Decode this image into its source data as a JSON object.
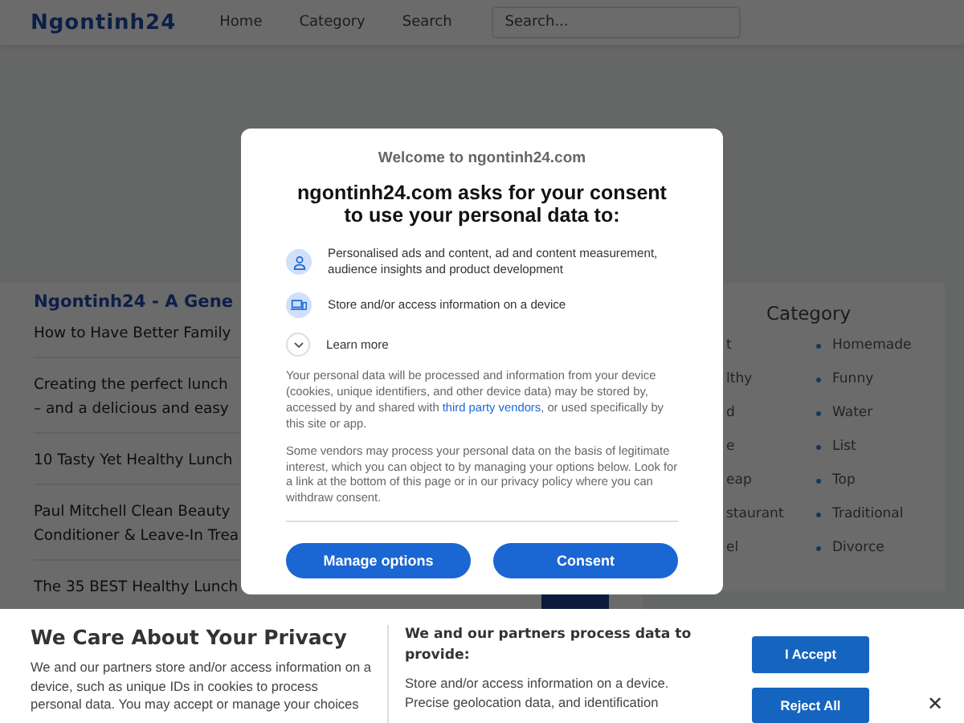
{
  "header": {
    "logo": "Ngontinh24",
    "nav": [
      "Home",
      "Category",
      "Search"
    ],
    "search": {
      "placeholder": "Search..."
    }
  },
  "articles": {
    "title": "Ngontinh24 - A Gene",
    "items": [
      {
        "lines": [
          "How to Have Better Family"
        ]
      },
      {
        "lines": [
          "Creating the perfect lunch",
          "– and a delicious and easy"
        ]
      },
      {
        "lines": [
          "10 Tasty Yet Healthy Lunch"
        ]
      },
      {
        "lines": [
          "Paul Mitchell Clean Beauty",
          "Conditioner & Leave-In Trea"
        ]
      },
      {
        "lines": [
          "The 35 BEST Healthy Lunch"
        ]
      }
    ]
  },
  "categories": {
    "title": "Category",
    "column_1": [
      "t",
      "lthy",
      "d",
      "e",
      "eap",
      "staurant",
      "el"
    ],
    "column_2": [
      "Homemade",
      "Funny",
      "Water",
      "List",
      "Top",
      "Traditional",
      "Divorce"
    ]
  },
  "consent_dialog": {
    "welcome": "Welcome to ngontinh24.com",
    "heading": "ngontinh24.com asks for your consent to use your personal data to:",
    "purposes": [
      {
        "kind": "person",
        "text": "Personalised ads and content, ad and content measurement, audience insights and product development"
      },
      {
        "kind": "device",
        "text": "Store and/or access information on a device"
      }
    ],
    "learn_more": {
      "label": "Learn more",
      "expanded": false
    },
    "paragraph_1": {
      "before": "Your personal data will be processed and information from your device (cookies, unique identifiers, and other device data) may be stored by, accessed by and shared with ",
      "link": "third party vendors",
      "after": ", or used specifically by this site or app."
    },
    "paragraph_2": "Some vendors may process your personal data on the basis of legitimate interest, which you can object to by managing your options below. Look for a link at the bottom of this page or in our privacy policy where you can withdraw consent.",
    "buttons": [
      "Manage options",
      "Consent"
    ]
  },
  "privacy_banner": {
    "title": "We Care About Your Privacy",
    "text": "We and our partners store and/or access information on a device, such as unique IDs in cookies to process personal data. You may accept or manage your choices",
    "purposes_title": "We and our partners process data to provide:",
    "purposes_text": "Store and/or access information on a device. Precise geolocation data, and identification",
    "buttons": [
      "I Accept",
      "Reject All"
    ],
    "close": "✕"
  }
}
